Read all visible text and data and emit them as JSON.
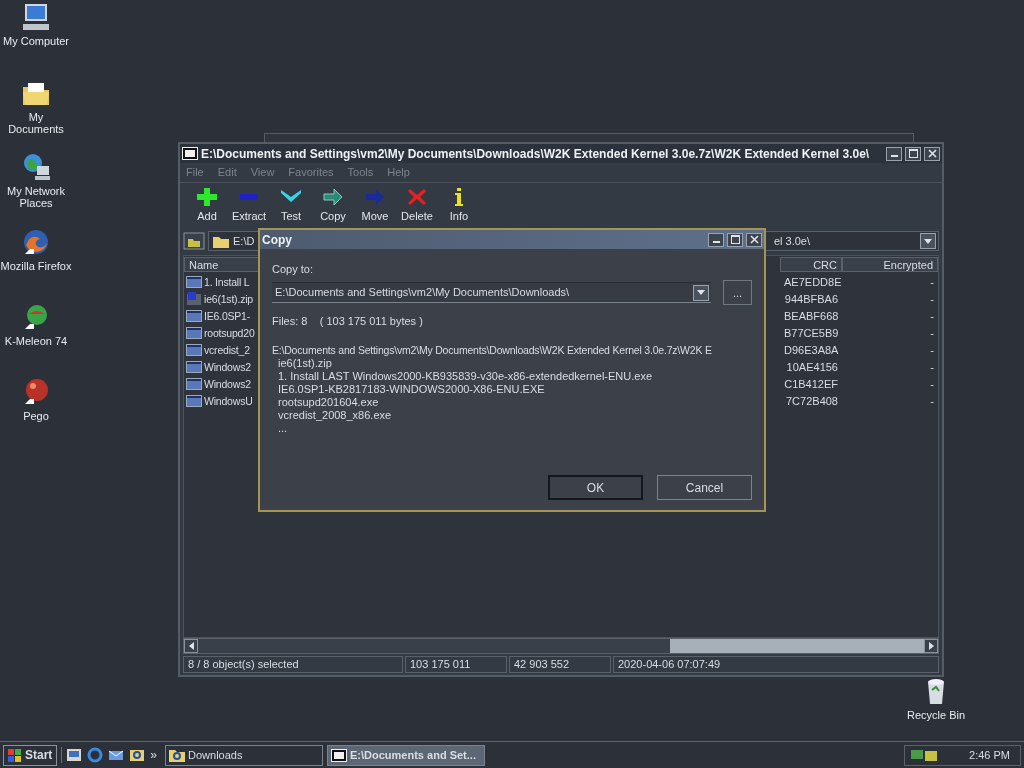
{
  "desktop_icons": [
    {
      "label": "My Computer"
    },
    {
      "label": "My Documents"
    },
    {
      "label": "My Network Places"
    },
    {
      "label": "Mozilla Firefox"
    },
    {
      "label": "K-Meleon 74"
    },
    {
      "label": "Pego"
    }
  ],
  "recycle_bin": {
    "label": "Recycle Bin"
  },
  "window": {
    "title": "E:\\Documents and Settings\\vm2\\My Documents\\Downloads\\W2K Extended Kernel 3.0e.7z\\W2K Extended Kernel 3.0e\\",
    "menu": [
      {
        "label": "File",
        "disabled": true
      },
      {
        "label": "Edit",
        "disabled": true
      },
      {
        "label": "View",
        "disabled": true
      },
      {
        "label": "Favorites",
        "disabled": true
      },
      {
        "label": "Tools",
        "disabled": true
      },
      {
        "label": "Help",
        "disabled": true
      }
    ],
    "toolbar": [
      {
        "label": "Add"
      },
      {
        "label": "Extract"
      },
      {
        "label": "Test"
      },
      {
        "label": "Copy"
      },
      {
        "label": "Move"
      },
      {
        "label": "Delete"
      },
      {
        "label": "Info"
      }
    ],
    "address": {
      "left": "E:\\D",
      "right": "el 3.0e\\"
    },
    "table": {
      "columns": [
        "Name",
        "CRC",
        "Encrypted"
      ],
      "rows": [
        {
          "name": "1. Install L",
          "crc": "AE7EDD8E",
          "encrypted": "-"
        },
        {
          "name": "ie6(1st).zip",
          "crc": "944BFBA6",
          "encrypted": "-"
        },
        {
          "name": "IE6.0SP1-",
          "crc": "BEABF668",
          "encrypted": "-"
        },
        {
          "name": "rootsupd20",
          "crc": "B77CE5B9",
          "encrypted": "-"
        },
        {
          "name": "vcredist_2",
          "crc": "D96E3A8A",
          "encrypted": "-"
        },
        {
          "name": "Windows2",
          "crc": "10AE4156",
          "encrypted": "-"
        },
        {
          "name": "Windows2",
          "crc": "C1B412EF",
          "encrypted": "-"
        },
        {
          "name": "WindowsU",
          "crc": "7C72B408",
          "encrypted": "-"
        }
      ]
    },
    "status_bar": [
      "8 / 8 object(s) selected",
      "103 175 011",
      "42 903 552",
      "2020-04-06 07:07:49"
    ]
  },
  "dialog": {
    "title": "Copy",
    "label": "Copy to:",
    "value": "E:\\Documents and Settings\\vm2\\My Documents\\Downloads\\",
    "browse": "...",
    "summary": "Files: 8    ( 103 175 011 bytes )",
    "source": "E:\\Documents and Settings\\vm2\\My Documents\\Downloads\\W2K Extended Kernel 3.0e.7z\\W2K E",
    "files": [
      "ie6(1st).zip",
      "1. Install LAST Windows2000-KB935839-v30e-x86-extendedkernel-ENU.exe",
      "IE6.0SP1-KB2817183-WINDOWS2000-X86-ENU.EXE",
      "rootsupd201604.exe",
      "vcredist_2008_x86.exe",
      "..."
    ],
    "buttons": [
      {
        "label": "OK",
        "selected": true
      },
      {
        "label": "Cancel",
        "selected": false
      }
    ]
  },
  "taskbar": {
    "start": "Start",
    "more": "»",
    "tasks": [
      {
        "label": "Downloads",
        "selected": false
      },
      {
        "label": "E:\\Documents and Set...",
        "selected": true
      }
    ],
    "clock": "2:46 PM"
  }
}
